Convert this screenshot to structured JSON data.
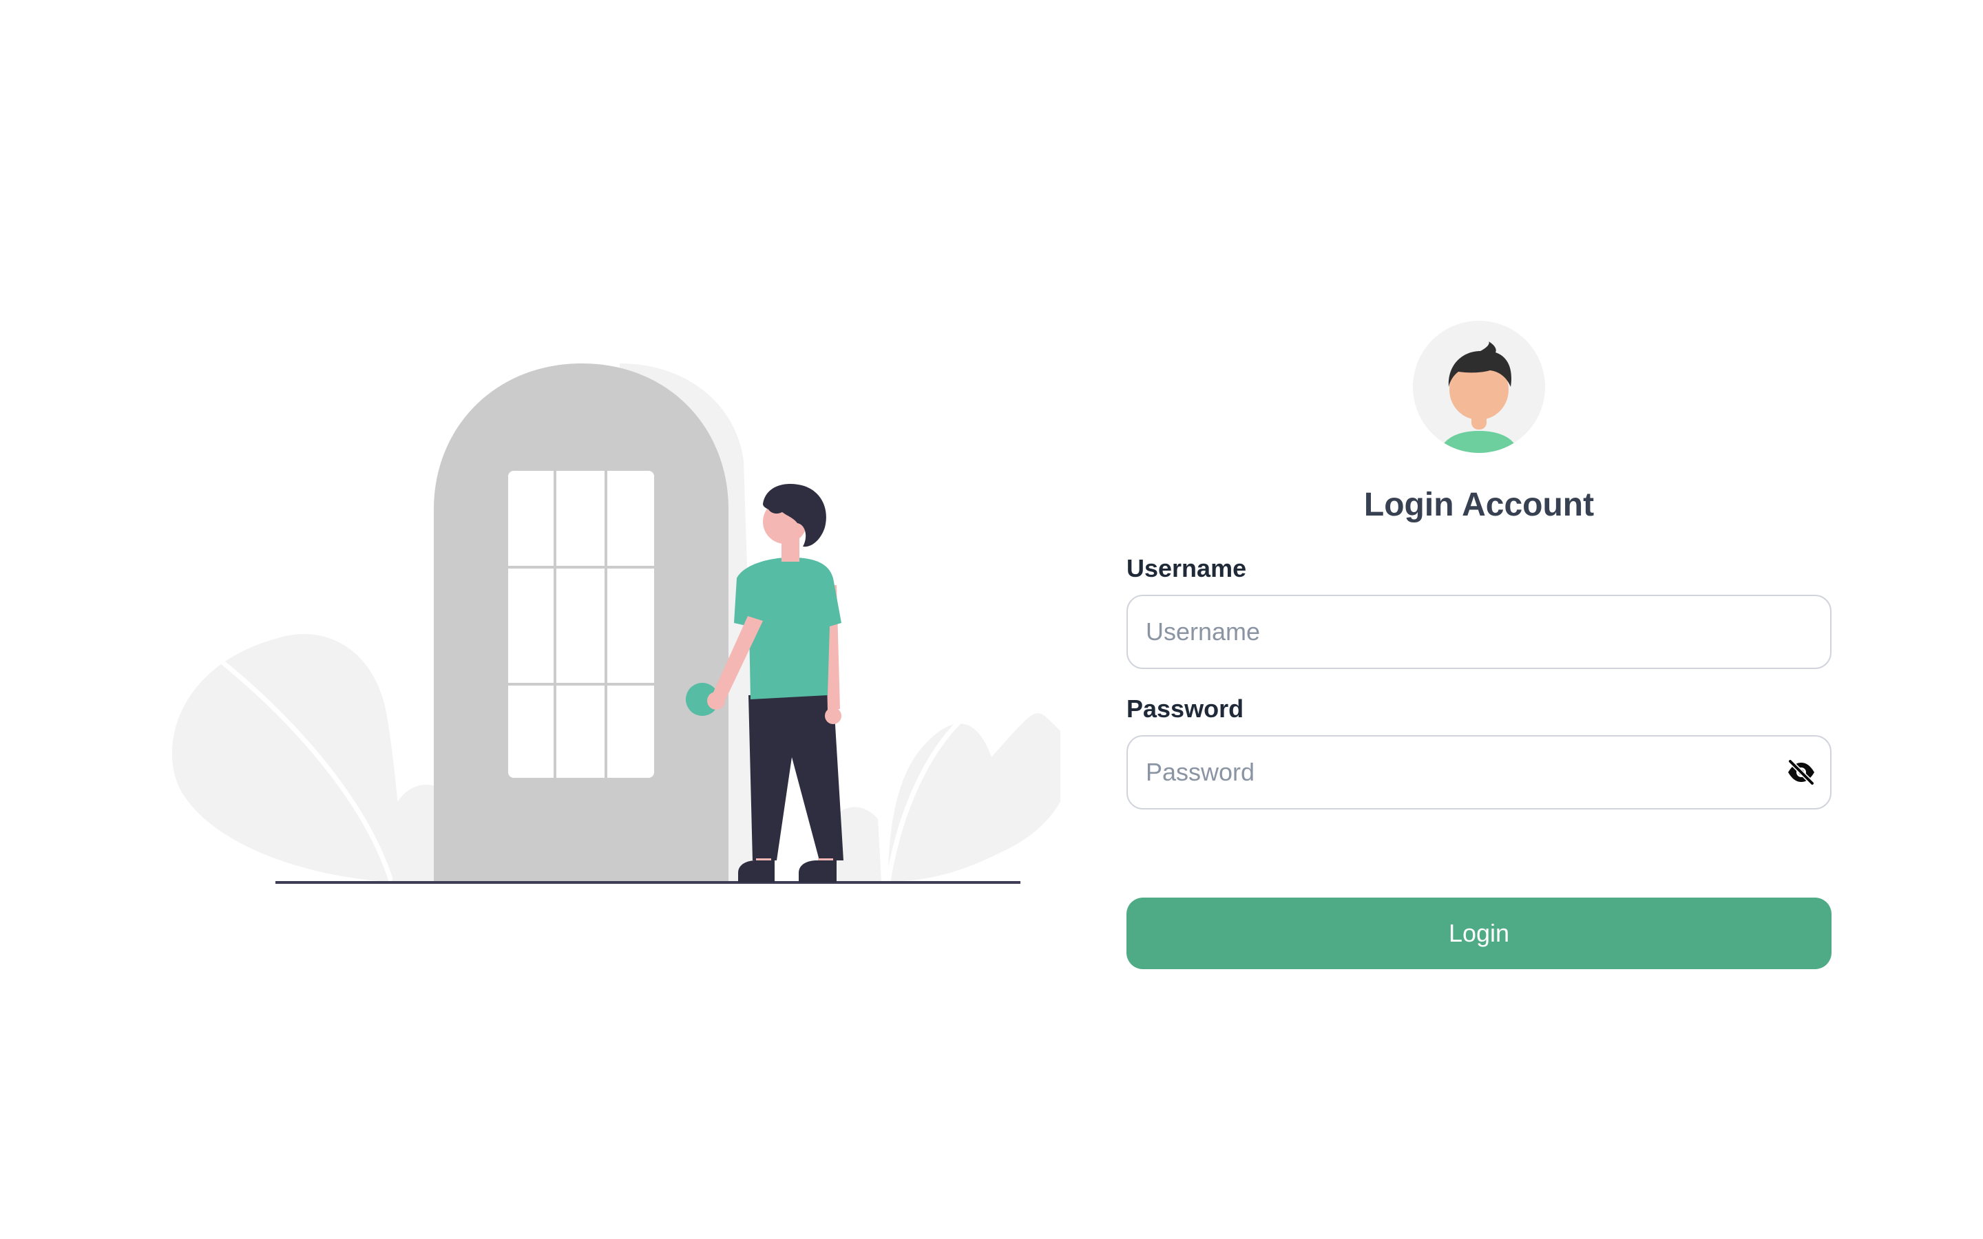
{
  "illustration": {
    "icon": "person-at-door-illustration"
  },
  "login": {
    "avatar_icon": "user-avatar-icon",
    "title": "Login Account",
    "username": {
      "label": "Username",
      "placeholder": "Username",
      "value": ""
    },
    "password": {
      "label": "Password",
      "placeholder": "Password",
      "value": "",
      "toggle_icon": "eye-slash-icon"
    },
    "submit_label": "Login"
  },
  "colors": {
    "accent": "#4fab86",
    "shirt": "#56bca4",
    "text_heading": "#374151",
    "input_border": "#d1d5db"
  }
}
